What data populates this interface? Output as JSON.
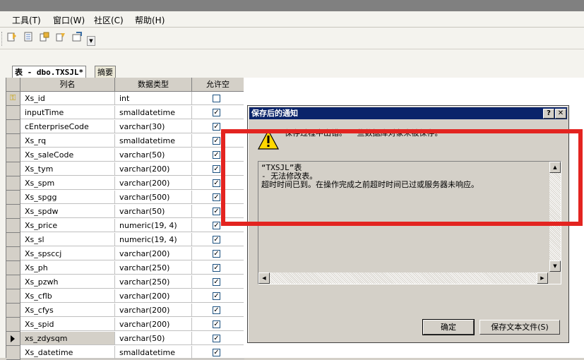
{
  "menu": [
    "工具(T)",
    "窗口(W)",
    "社区(C)",
    "帮助(H)"
  ],
  "tabs": {
    "active": "表 - dbo.TXSJL*",
    "other": "摘要"
  },
  "grid": {
    "headers": [
      "列名",
      "数据类型",
      "允许空"
    ],
    "rows": [
      {
        "name": "Xs_id",
        "type": "int",
        "nullable": false,
        "key": true
      },
      {
        "name": "inputTime",
        "type": "smalldatetime",
        "nullable": true
      },
      {
        "name": "cEnterpriseCode",
        "type": "varchar(30)",
        "nullable": true
      },
      {
        "name": "Xs_rq",
        "type": "smalldatetime",
        "nullable": true
      },
      {
        "name": "Xs_saleCode",
        "type": "varchar(50)",
        "nullable": true
      },
      {
        "name": "Xs_tym",
        "type": "varchar(200)",
        "nullable": true
      },
      {
        "name": "Xs_spm",
        "type": "varchar(200)",
        "nullable": true
      },
      {
        "name": "Xs_spgg",
        "type": "varchar(500)",
        "nullable": true
      },
      {
        "name": "Xs_spdw",
        "type": "varchar(50)",
        "nullable": true
      },
      {
        "name": "Xs_price",
        "type": "numeric(19, 4)",
        "nullable": true
      },
      {
        "name": "Xs_sl",
        "type": "numeric(19, 4)",
        "nullable": true
      },
      {
        "name": "Xs_spsccj",
        "type": "varchar(200)",
        "nullable": true
      },
      {
        "name": "Xs_ph",
        "type": "varchar(250)",
        "nullable": true
      },
      {
        "name": "Xs_pzwh",
        "type": "varchar(250)",
        "nullable": true
      },
      {
        "name": "Xs_cflb",
        "type": "varchar(200)",
        "nullable": true
      },
      {
        "name": "Xs_cfys",
        "type": "varchar(200)",
        "nullable": true
      },
      {
        "name": "Xs_spid",
        "type": "varchar(200)",
        "nullable": true
      },
      {
        "name": "xs_zdysqm",
        "type": "varchar(50)",
        "nullable": true,
        "current": true
      },
      {
        "name": "Xs_datetime",
        "type": "smalldatetime",
        "nullable": true
      }
    ]
  },
  "dialog": {
    "title": "保存后的通知",
    "help_btn": "?",
    "close_btn": "✕",
    "message": "保存过程中出错。 一些数据库对象未被保存。",
    "details": "“TXSJL”表\n- 无法修改表。\n超时时间已到。在操作完成之前超时时间已过或服务器未响应。",
    "ok": "确定",
    "save_text": "保存文本文件(S)"
  },
  "colors": {
    "annotation": "#e32420",
    "dialog_title": "#0a246a"
  }
}
